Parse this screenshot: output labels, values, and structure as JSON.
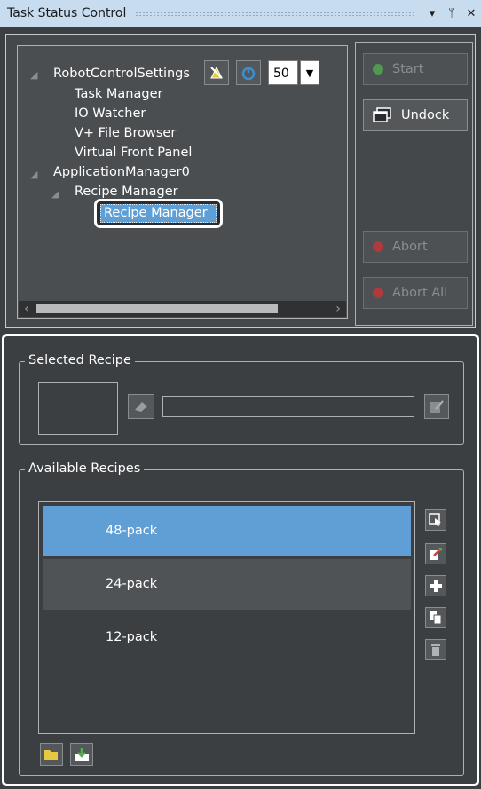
{
  "window": {
    "title": "Task Status Control",
    "controls": {
      "dropdown": "▾",
      "pin": "ᛘ",
      "close": "✕"
    }
  },
  "tree": {
    "items": [
      {
        "label": "RobotControlSettings",
        "expanded": true
      },
      {
        "label": "Task Manager"
      },
      {
        "label": "IO Watcher"
      },
      {
        "label": "V+ File Browser"
      },
      {
        "label": "Virtual Front Panel"
      },
      {
        "label": "ApplicationManager0",
        "expanded": true
      },
      {
        "label": "Recipe Manager",
        "expanded": true
      },
      {
        "label": "Recipe Manager",
        "selected": true
      }
    ],
    "toolbar": {
      "count_value": "50",
      "dropdown_arrow": "▼"
    }
  },
  "controls": {
    "start_label": "Start",
    "undock_label": "Undock",
    "abort_label": "Abort",
    "abort_all_label": "Abort All"
  },
  "selected_recipe": {
    "group_label": "Selected Recipe",
    "name_value": ""
  },
  "available_recipes": {
    "group_label": "Available Recipes",
    "items": [
      {
        "label": "48-pack",
        "selected": true
      },
      {
        "label": "24-pack"
      },
      {
        "label": "12-pack"
      }
    ]
  },
  "colors": {
    "selection": "#5f9fd6",
    "panel": "#3c3f42",
    "titlebar": "#c8dcf0",
    "start_dot": "#4f9a4f",
    "abort_dot": "#b03a3a",
    "power_icon": "#3a8fd0"
  },
  "icons": [
    "robot-settings-icon",
    "power-icon",
    "undock-icon",
    "edit-icon",
    "select-icon",
    "add-icon",
    "copy-icon",
    "delete-icon",
    "open-folder-icon",
    "import-icon"
  ]
}
